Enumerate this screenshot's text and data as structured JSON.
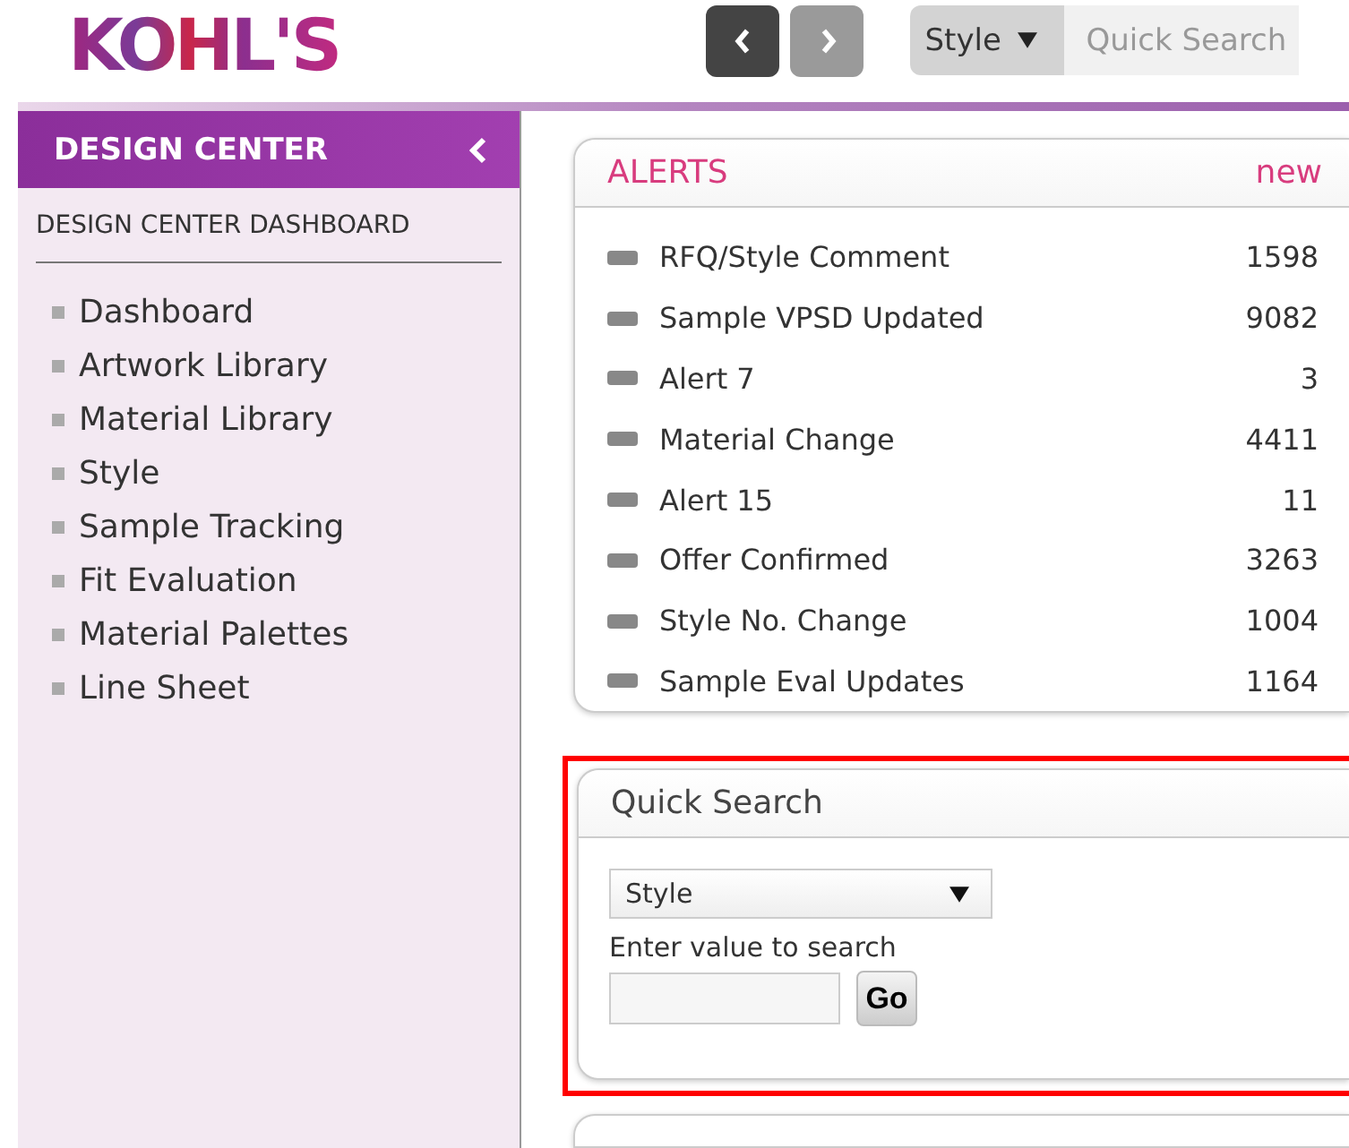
{
  "header": {
    "logo": "KOHL'S",
    "nav": [
      {
        "kind": "back",
        "disabled": false
      },
      {
        "kind": "forward",
        "disabled": true
      }
    ],
    "search": {
      "type": "Style",
      "placeholder": "Quick Search"
    }
  },
  "sidebar": {
    "title": "DESIGN CENTER",
    "subtitle": "DESIGN CENTER DASHBOARD",
    "items": [
      {
        "label": "Dashboard"
      },
      {
        "label": "Artwork Library"
      },
      {
        "label": "Material Library"
      },
      {
        "label": "Style"
      },
      {
        "label": "Sample Tracking"
      },
      {
        "label": "Fit Evaluation"
      },
      {
        "label": "Material Palettes"
      },
      {
        "label": "Line Sheet"
      }
    ]
  },
  "alerts": {
    "title": "ALERTS",
    "link": "new",
    "rows": [
      {
        "label": "RFQ/Style Comment",
        "count": "1598"
      },
      {
        "label": "Sample VPSD Updated",
        "count": "9082"
      },
      {
        "label": "Alert 7",
        "count": "3"
      },
      {
        "label": "Material Change",
        "count": "4411"
      },
      {
        "label": "Alert 15",
        "count": "11"
      },
      {
        "label": "Offer Confirmed",
        "count": "3263"
      },
      {
        "label": "Style No. Change",
        "count": "1004"
      },
      {
        "label": "Sample Eval Updates",
        "count": "1164"
      }
    ]
  },
  "quick_search": {
    "title": "Quick Search",
    "highlighted": true,
    "type": "Style",
    "label": "Enter value to search",
    "button": "Go"
  }
}
